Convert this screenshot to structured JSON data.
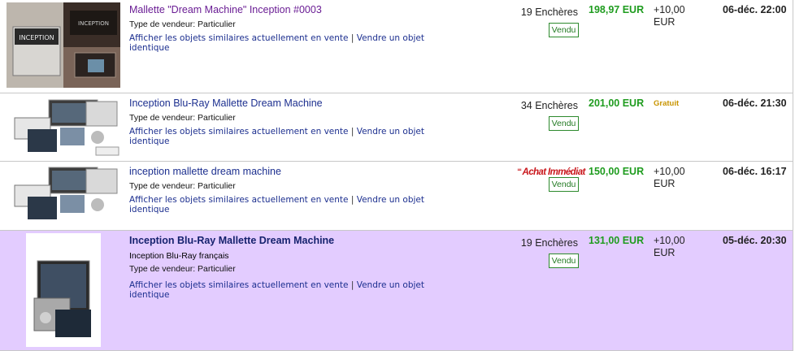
{
  "listings": [
    {
      "title": "Mallette \"Dream Machine\" Inception #0003",
      "subtitle": "",
      "seller": "Type de vendeur: Particulier",
      "similar_link": "Afficher les objets similaires actuellement en vente",
      "separator": "|",
      "identical_link": "Vendre un objet identique",
      "bids": "19 Enchères",
      "buy_it_now": "",
      "status": "Vendu",
      "price": "198,97 EUR",
      "shipping": "+10,00 EUR",
      "end": "06-déc. 22:00",
      "thumbnail_text": "INCEPTION"
    },
    {
      "title": "Inception Blu-Ray Mallette Dream Machine",
      "subtitle": "",
      "seller": "Type de vendeur: Particulier",
      "similar_link": "Afficher les objets similaires actuellement en vente",
      "separator": "|",
      "identical_link": "Vendre un objet identique",
      "bids": "34 Enchères",
      "buy_it_now": "",
      "status": "Vendu",
      "price": "201,00 EUR",
      "shipping": "Gratuit",
      "end": "06-déc. 21:30"
    },
    {
      "title": "inception mallette dream machine",
      "subtitle": "",
      "seller": "Type de vendeur: Particulier",
      "similar_link": "Afficher les objets similaires actuellement en vente",
      "separator": "|",
      "identical_link": "Vendre un objet identique",
      "bids": "",
      "buy_it_now": "Achat Immédiat",
      "status": "Vendu",
      "price": "150,00 EUR",
      "shipping": "+10,00 EUR",
      "end": "06-déc. 16:17"
    },
    {
      "title": "Inception Blu-Ray Mallette Dream Machine",
      "subtitle": "Inception Blu-Ray français",
      "seller": "Type de vendeur: Particulier",
      "similar_link": "Afficher les objets similaires actuellement en vente",
      "separator": "|",
      "identical_link": "Vendre un objet identique",
      "bids": "19 Enchères",
      "buy_it_now": "",
      "status": "Vendu",
      "price": "131,00 EUR",
      "shipping": "+10,00 EUR",
      "end": "05-déc. 20:30"
    }
  ],
  "colors": {
    "highlight_row": "#e3ccff",
    "price_green": "#1f9c1f",
    "visited_link": "#6a1d94",
    "link_blue": "#1c2f8f",
    "free_shipping": "#c89400"
  }
}
